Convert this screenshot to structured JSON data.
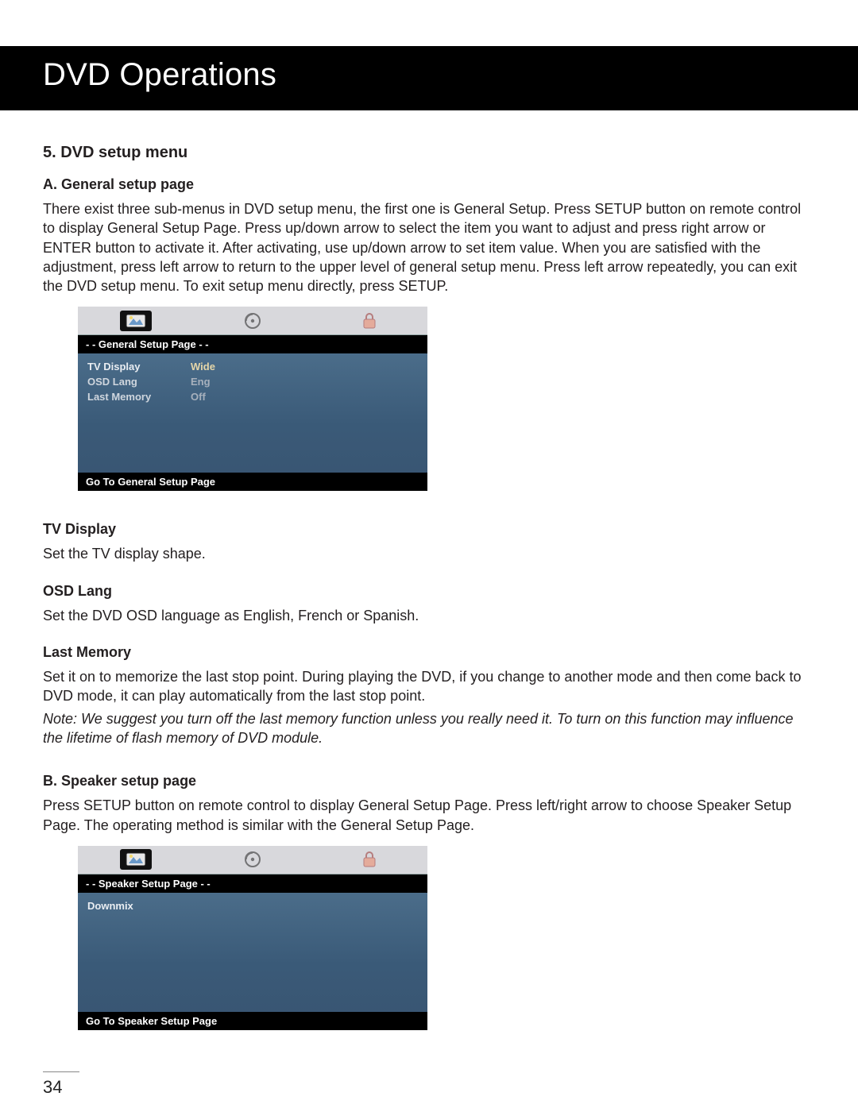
{
  "header": {
    "title": "DVD Operations"
  },
  "section5": {
    "heading": "5. DVD setup menu",
    "A": {
      "heading": "A. General setup page",
      "paragraph": "There exist three sub-menus in DVD setup menu, the first one is General Setup. Press SETUP button on remote control to display General Setup Page. Press up/down arrow to select the item you want to adjust and press right arrow or ENTER button to activate it. After activating, use up/down arrow to set item value. When you are satisfied with the adjustment, press left arrow to return to the upper level of general setup menu. Press left arrow repeatedly, you can exit the DVD setup menu. To exit setup menu directly, press SETUP."
    },
    "osd_general": {
      "tab_icons": [
        "picture-icon",
        "disc-icon",
        "lock-icon"
      ],
      "active_tab": 0,
      "title": "- -  General  Setup  Page  - -",
      "rows": [
        {
          "label": "TV   Display",
          "value": "Wide",
          "highlight": true
        },
        {
          "label": "OSD  Lang",
          "value": "Eng"
        },
        {
          "label": "Last   Memory",
          "value": "Off"
        }
      ],
      "footer": "Go  To  General  Setup   Page"
    },
    "tv_display": {
      "heading": "TV Display",
      "text": "Set the TV display shape."
    },
    "osd_lang": {
      "heading": "OSD Lang",
      "text": "Set the DVD OSD language as English, French or Spanish."
    },
    "last_memory": {
      "heading": "Last Memory",
      "text1": "Set it on to memorize the last stop point. During playing the DVD, if you change to another mode and then come back to DVD mode, it can play automatically from the last stop point.",
      "note": "Note: We suggest you turn off the last memory function unless you really need it. To turn on this function may influence the lifetime of flash memory of DVD module."
    },
    "B": {
      "heading": "B. Speaker setup page",
      "paragraph": "Press SETUP button on remote control to display General Setup Page. Press left/right arrow to choose Speaker Setup Page. The operating method is similar with the General Setup Page."
    },
    "osd_speaker": {
      "tab_icons": [
        "picture-icon",
        "disc-icon",
        "lock-icon"
      ],
      "active_tab": 0,
      "title": "- -  Speaker  Setup  Page  - -",
      "rows": [
        {
          "label": "Downmix",
          "value": "",
          "highlight": true
        }
      ],
      "footer": "Go  To  Speaker  Setup   Page"
    }
  },
  "page_number": "34"
}
